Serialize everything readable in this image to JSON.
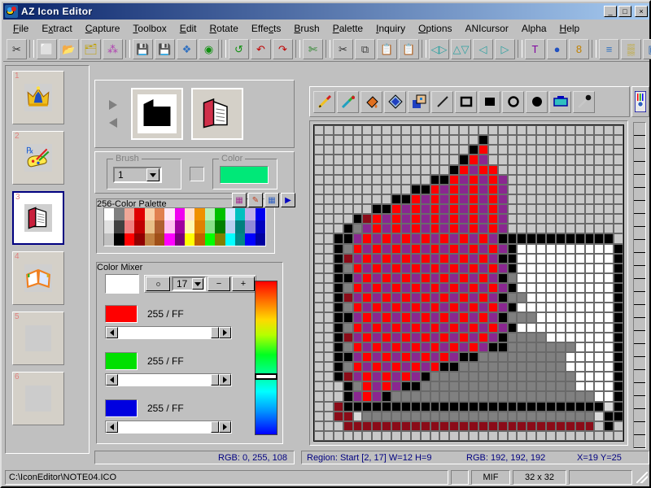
{
  "window": {
    "title": "AZ  Icon Editor",
    "app_icon": "palette-bug-icon",
    "minimize_label": "_",
    "maximize_label": "□",
    "close_label": "×"
  },
  "menu": {
    "items": [
      {
        "label": "File",
        "accel": "F"
      },
      {
        "label": "Extract",
        "accel": "x"
      },
      {
        "label": "Capture",
        "accel": "C"
      },
      {
        "label": "Toolbox",
        "accel": "T"
      },
      {
        "label": "Edit",
        "accel": "E"
      },
      {
        "label": "Rotate",
        "accel": "R"
      },
      {
        "label": "Effects",
        "accel": "c"
      },
      {
        "label": "Brush",
        "accel": "B"
      },
      {
        "label": "Palette",
        "accel": "P"
      },
      {
        "label": "Inquiry",
        "accel": "I"
      },
      {
        "label": "Options",
        "accel": "O"
      },
      {
        "label": "ANIcursor",
        "accel": ""
      },
      {
        "label": "Alpha",
        "accel": ""
      },
      {
        "label": "Help",
        "accel": "H"
      }
    ]
  },
  "toolbar": {
    "buttons": [
      {
        "name": "new-from-capture-icon",
        "glyph": "✂︎"
      },
      {
        "name": "new-file-icon",
        "glyph": "⬜"
      },
      {
        "name": "open-folder-icon",
        "glyph": "📂"
      },
      {
        "name": "open-library-icon",
        "glyph": "🗂"
      },
      {
        "name": "molecule-icon",
        "glyph": "⁂"
      },
      {
        "name": "save-icon",
        "glyph": "💾"
      },
      {
        "name": "save-as-icon",
        "glyph": "💾"
      },
      {
        "name": "effects-icon",
        "glyph": "❖"
      },
      {
        "name": "capture-screen-icon",
        "glyph": "◉"
      },
      {
        "name": "refresh-icon",
        "glyph": "↺"
      },
      {
        "name": "undo-icon",
        "glyph": "↶"
      },
      {
        "name": "redo-icon",
        "glyph": "↷"
      },
      {
        "name": "crop-icon",
        "glyph": "✄"
      },
      {
        "name": "cut-icon",
        "glyph": "✂"
      },
      {
        "name": "copy-icon",
        "glyph": "⧉"
      },
      {
        "name": "paste-icon",
        "glyph": "📋"
      },
      {
        "name": "paste-special-icon",
        "glyph": "📋"
      },
      {
        "name": "flip-horizontal-icon",
        "glyph": "◁▷"
      },
      {
        "name": "flip-vertical-icon",
        "glyph": "△▽"
      },
      {
        "name": "rotate-left-icon",
        "glyph": "◁"
      },
      {
        "name": "rotate-right-icon",
        "glyph": "▷"
      },
      {
        "name": "text-tool-icon",
        "glyph": "T"
      },
      {
        "name": "sphere-icon",
        "glyph": "●"
      },
      {
        "name": "depth-8bit-icon",
        "glyph": "8"
      },
      {
        "name": "list-icon",
        "glyph": "≡"
      },
      {
        "name": "filmstrip-icon",
        "glyph": "▒"
      },
      {
        "name": "image-properties-icon",
        "glyph": "▣"
      }
    ]
  },
  "icon_strip": {
    "items": [
      {
        "number": "1",
        "name": "crown-icon",
        "selected": false,
        "empty": false
      },
      {
        "number": "2",
        "name": "palette-brushes-icon",
        "selected": false,
        "empty": false
      },
      {
        "number": "3",
        "name": "closed-book-icon",
        "selected": true,
        "empty": false
      },
      {
        "number": "4",
        "name": "open-book-icon",
        "selected": false,
        "empty": false
      },
      {
        "number": "5",
        "name": "empty-slot",
        "selected": false,
        "empty": true
      },
      {
        "number": "6",
        "name": "empty-slot",
        "selected": false,
        "empty": true
      }
    ]
  },
  "preview": {
    "next_arrow": "arrow-right-icon",
    "prev_arrow": "arrow-left-icon",
    "mask_preview_name": "icon-mask-preview",
    "image_preview_name": "icon-image-preview"
  },
  "brush": {
    "legend": "Brush",
    "size_value": "1",
    "shape_name": "brush-shape-square"
  },
  "color": {
    "legend": "Color",
    "current_hex": "#00e878"
  },
  "palette": {
    "legend": "256-Color Palette",
    "buttons": [
      {
        "name": "palette-grid-icon",
        "glyph": "▦"
      },
      {
        "name": "palette-pick-icon",
        "glyph": "✎"
      },
      {
        "name": "palette-table-icon",
        "glyph": "▦"
      },
      {
        "name": "palette-next-icon",
        "glyph": "▶"
      }
    ],
    "swatches": [
      "#ffffff",
      "#808080",
      "#f0a898",
      "#e00000",
      "#f8d0a8",
      "#e08050",
      "#ffe8f8",
      "#f000f0",
      "#ffe0d0",
      "#f09000",
      "#b8f0b8",
      "#00c000",
      "#d8e8ff",
      "#00c0c0",
      "#c0b0e8",
      "#0000f0",
      "#e0e0e0",
      "#404040",
      "#f08080",
      "#c00000",
      "#e8c088",
      "#b06030",
      "#ffc0f0",
      "#a000a0",
      "#fff8b0",
      "#e08000",
      "#88e088",
      "#008000",
      "#b8d0f0",
      "#008080",
      "#9088d8",
      "#0000c0",
      "#c0c0c0",
      "#000000",
      "#ff0000",
      "#900000",
      "#c08040",
      "#a05018",
      "#ff00ff",
      "#780078",
      "#ffff00",
      "#c06000",
      "#00ff00",
      "#808000",
      "#00ffff",
      "#008888",
      "#0000ff",
      "#0000a0"
    ]
  },
  "mixer": {
    "legend": "Color Mixer",
    "preview_hex": "#ffffff",
    "shape_button": "circle-icon",
    "index_value": "17",
    "minus_label": "−",
    "plus_label": "+",
    "channels": [
      {
        "name": "red",
        "swatch": "#ff0000",
        "label": "255 / FF",
        "percent": 100
      },
      {
        "name": "green",
        "swatch": "#00e000",
        "label": "255 / FF",
        "percent": 100
      },
      {
        "name": "blue",
        "swatch": "#0000e0",
        "label": "255 / FF",
        "percent": 100
      }
    ]
  },
  "tools": {
    "items": [
      {
        "name": "pencil-tool",
        "selected": false
      },
      {
        "name": "airbrush-tool",
        "selected": false
      },
      {
        "name": "fill-tool",
        "selected": false
      },
      {
        "name": "gradient-fill-tool",
        "selected": false
      },
      {
        "name": "select-region-tool",
        "selected": false
      },
      {
        "name": "line-tool",
        "selected": false
      },
      {
        "name": "rectangle-outline-tool",
        "selected": false
      },
      {
        "name": "rectangle-filled-tool",
        "selected": false
      },
      {
        "name": "ellipse-outline-tool",
        "selected": false
      },
      {
        "name": "ellipse-filled-tool",
        "selected": false
      },
      {
        "name": "screen-capture-tool",
        "selected": false
      },
      {
        "name": "eyedropper-tool",
        "selected": false
      }
    ],
    "ruler_button": "color-ruler-icon"
  },
  "status": {
    "mixer_rgb": "RGB: 0, 255, 108",
    "region": "Region: Start [2, 17]   W=12 H=9",
    "pixel_rgb": "RGB: 192, 192, 192",
    "coords": "X=19  Y=25"
  },
  "statusbar": {
    "path": "C:\\IconEditor\\NOTE04.ICO",
    "blank1": "",
    "format": "MIF",
    "size": "32 x 32",
    "blank2": ""
  },
  "canvas": {
    "width": 32,
    "height": 32,
    "legend": {
      ".": "#c8c8c8",
      "k": "#000000",
      "r": "#ff0000",
      "p": "#8a2790",
      "d": "#8b0b18",
      "w": "#ffffff",
      "g": "#808080",
      "l": "#d9d9d9",
      "x": "#ffffff"
    },
    "rows": [
      "................................",
      ".................k..............",
      "................kr..............",
      "...............krp..............",
      "..............krprr.............",
      "............kkrprprp............",
      "..........kkrprprprp............",
      "........kkrprprprprp............",
      "......kkrprprprprprp............",
      "....kdrprprprprprprp............",
      "...kgprprprprprprprp............",
      "..kkprprprprprprprpkkkkkkkkkkkk.",
      "..kgrprprprprprprprpkwwwwwwwwwwk",
      "..kdprprprprprprprpkkwwwwwwwwwwk",
      "..kgrprprprprprprprpkwwwwwwwwwwk",
      "..kkprprprprprprprpkgwwwwwwwwwwk",
      "..kgrprprprprprprprpkwwwwwwwwwwk",
      "..kdprprprprprprprpkggwwwwwwwwwk",
      "..kgrprprprprprprprpkwwwwwwwwwwk",
      "..kkprprprprprprprpkgggwwwwwwwwk",
      "..kgrprprprprprprprpkwwwwwwwwwwk",
      "..kdprprprprprprprpkggggwwwwwwwk",
      "..kgrprprprprprprpkkgggggggwwwwk",
      "..kkprprprprprpkkgggggggggwwwwwk",
      "..kgrprprprprkkgggggggggggwwwwwk",
      "..kdprprprpkgggggggggggggggwwwwk",
      "...kgrprpkkggggggggggggggggwwwwk",
      "...kprpkgggggggggggggggggggggwwk",
      "..dkkkkkkkkkkkkkkkkkkkkkkkkkkklk",
      "..ddlgggggggggggggggggggggggglkk",
      "...dddddddddddddddddddddddddd.k.",
      "................................"
    ]
  }
}
